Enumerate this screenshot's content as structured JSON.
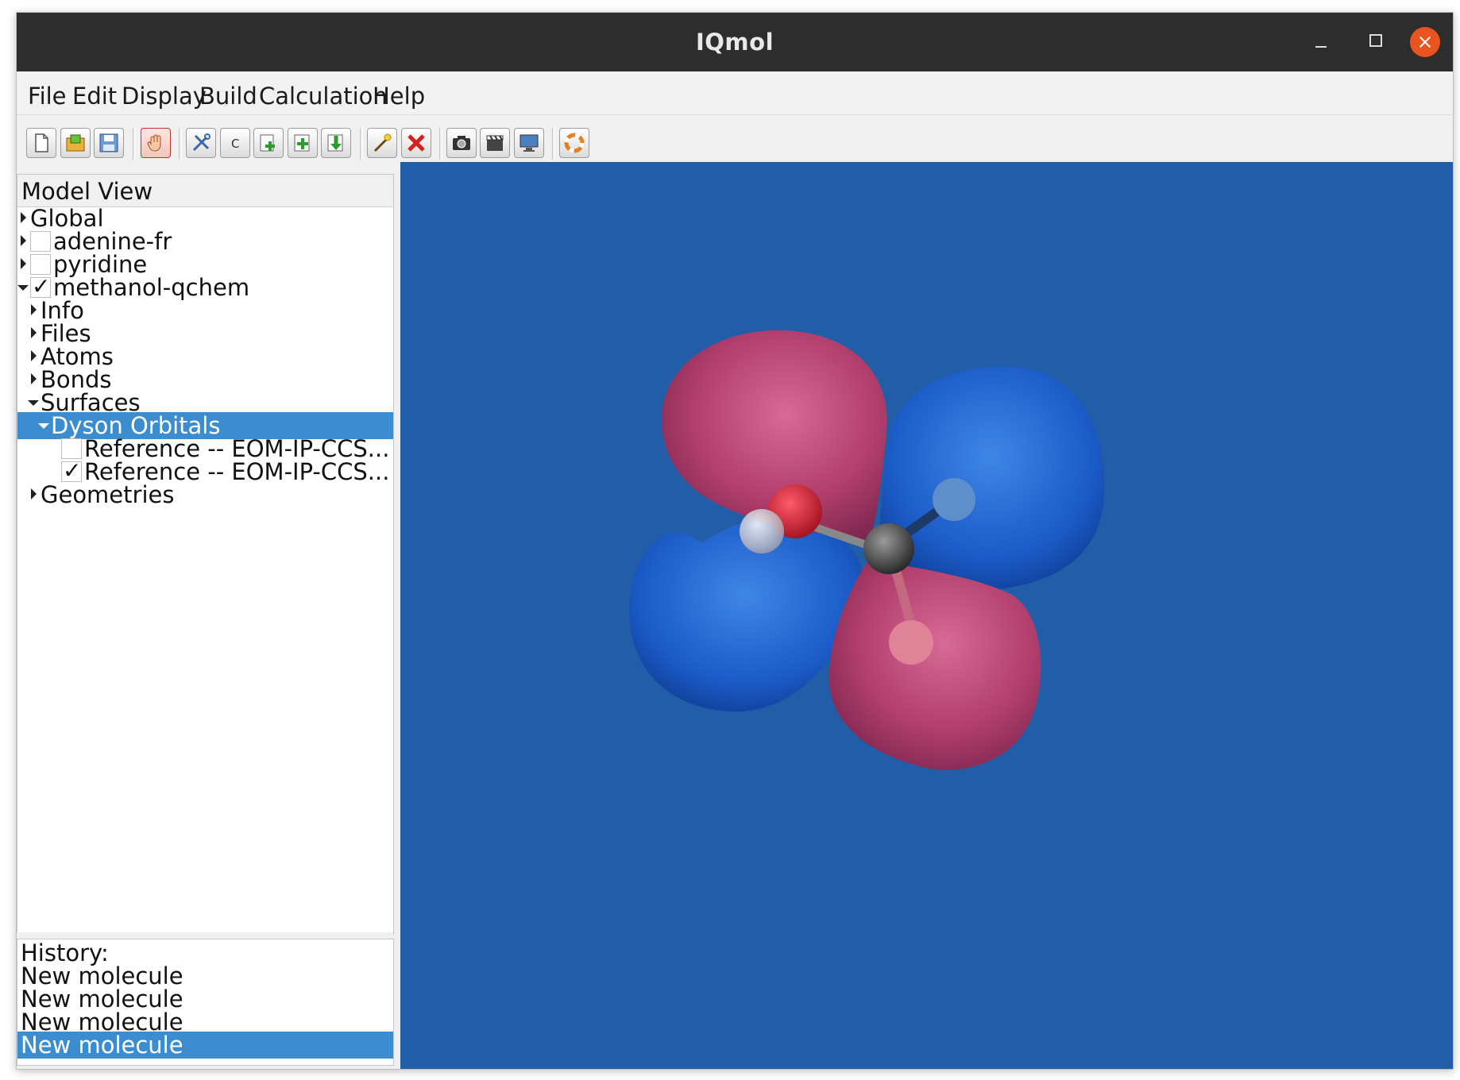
{
  "window": {
    "title": "IQmol"
  },
  "menu": [
    "File",
    "Edit",
    "Display",
    "Build",
    "Calculation",
    "Help"
  ],
  "toolbar": {
    "new": "new-file-icon",
    "open": "open-folder-icon",
    "save": "save-disk-icon",
    "manipulate": "hand-icon",
    "build": "tools-icon",
    "element": "C",
    "add_fragment": "add-fragment-icon",
    "add_hydrogens": "add-hydrogens-icon",
    "minimize": "minimize-down-icon",
    "select": "wand-icon",
    "delete": "delete-x-icon",
    "screenshot": "camera-icon",
    "record": "film-icon",
    "fullscreen": "monitor-icon",
    "help": "lifebuoy-icon"
  },
  "model_view": {
    "header": "Model View",
    "items": [
      {
        "label": "Global",
        "expanded": false,
        "checkbox": null
      },
      {
        "label": "adenine-fr",
        "expanded": false,
        "checkbox": false
      },
      {
        "label": "pyridine",
        "expanded": false,
        "checkbox": false
      },
      {
        "label": "methanol-qchem",
        "expanded": true,
        "checkbox": true
      },
      {
        "label": "Info",
        "expanded": false
      },
      {
        "label": "Files",
        "expanded": false
      },
      {
        "label": "Atoms",
        "expanded": false
      },
      {
        "label": "Bonds",
        "expanded": false
      },
      {
        "label": "Surfaces",
        "expanded": true
      },
      {
        "label": "Dyson Orbitals",
        "expanded": true,
        "selected": true
      },
      {
        "label": "Reference -- EOM-IP-CCS...",
        "checkbox": false
      },
      {
        "label": "Reference -- EOM-IP-CCS...",
        "checkbox": true
      },
      {
        "label": "Geometries",
        "expanded": false
      }
    ]
  },
  "history": {
    "header": "History:",
    "items": [
      "New molecule",
      "New molecule",
      "New molecule",
      "New molecule"
    ],
    "selected_index": 3
  },
  "viewer": {
    "background_color": "#225da8",
    "positive_lobe_color": "#c8386c",
    "negative_lobe_color": "#1f5fd0",
    "atoms": [
      "O",
      "C",
      "H",
      "H",
      "H"
    ]
  }
}
